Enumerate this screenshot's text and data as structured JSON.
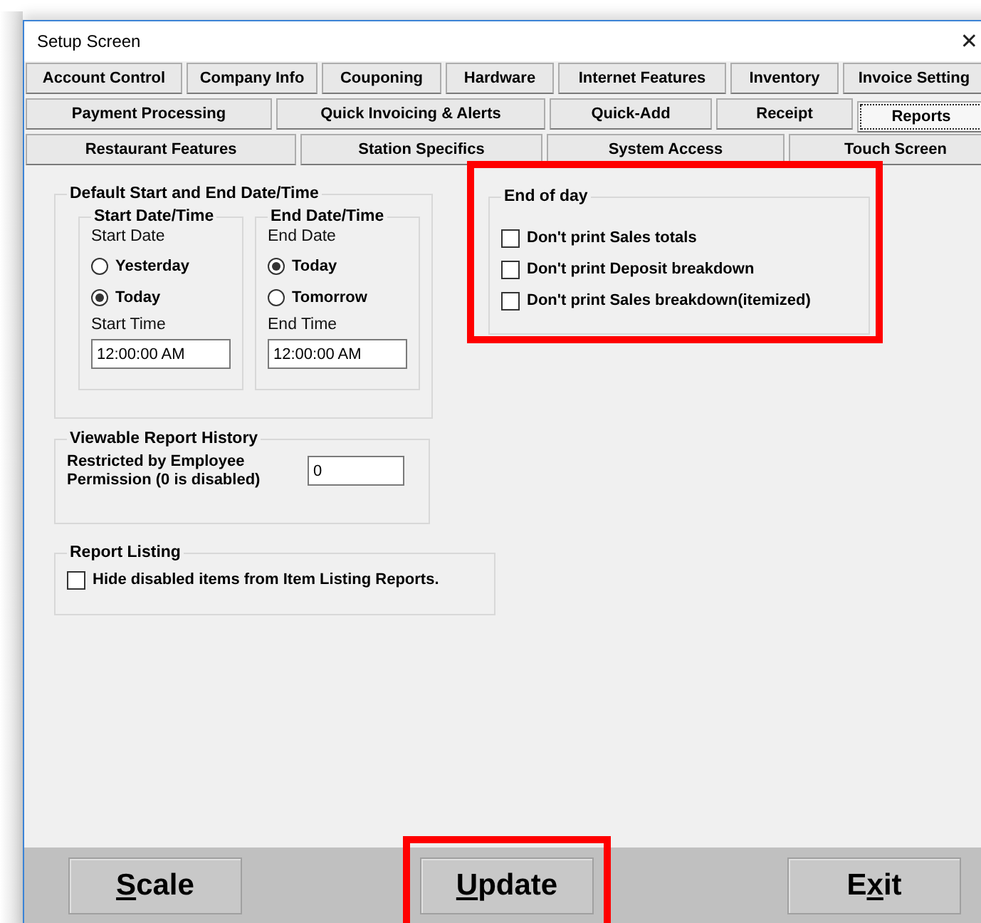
{
  "window": {
    "title": "Setup Screen",
    "close": "✕"
  },
  "tab_rows": [
    [
      {
        "label": "Account Control",
        "selected": false
      },
      {
        "label": "Company Info",
        "selected": false
      },
      {
        "label": "Couponing",
        "selected": false
      },
      {
        "label": "Hardware",
        "selected": false
      },
      {
        "label": "Internet Features",
        "selected": false
      },
      {
        "label": "Inventory",
        "selected": false
      },
      {
        "label": "Invoice Setting",
        "selected": false
      }
    ],
    [
      {
        "label": "Payment Processing",
        "selected": false
      },
      {
        "label": "Quick Invoicing & Alerts",
        "selected": false
      },
      {
        "label": "Quick-Add",
        "selected": false
      },
      {
        "label": "Receipt",
        "selected": false
      },
      {
        "label": "Reports",
        "selected": true
      }
    ],
    [
      {
        "label": "Restaurant Features",
        "selected": false
      },
      {
        "label": "Station Specifics",
        "selected": false
      },
      {
        "label": "System Access",
        "selected": false
      },
      {
        "label": "Touch Screen",
        "selected": false
      }
    ]
  ],
  "date_time_group": {
    "title": "Default Start and End Date/Time",
    "panels": [
      {
        "title": "Start Date/Time",
        "date_label": "Start Date",
        "options": [
          {
            "label": "Yesterday",
            "selected": false
          },
          {
            "label": "Today",
            "selected": true
          }
        ],
        "time_label": "Start Time",
        "time_value": "12:00:00 AM"
      },
      {
        "title": "End Date/Time",
        "date_label": "End Date",
        "options": [
          {
            "label": "Today",
            "selected": true
          },
          {
            "label": "Tomorrow",
            "selected": false
          }
        ],
        "time_label": "End Time",
        "time_value": "12:00:00 AM"
      }
    ]
  },
  "history_group": {
    "title": "Viewable Report History",
    "label": "Restricted by Employee Permission (0 is disabled)",
    "value": "0"
  },
  "listing_group": {
    "title": "Report Listing",
    "options": [
      {
        "label": "Hide disabled items from Item Listing Reports.",
        "checked": false
      }
    ]
  },
  "end_of_day_group": {
    "title": "End of day",
    "highlighted": true,
    "options": [
      {
        "label": "Don't print Sales totals",
        "checked": false
      },
      {
        "label": "Don't print Deposit breakdown",
        "checked": false
      },
      {
        "label": "Don't print Sales breakdown(itemized)",
        "checked": false
      }
    ]
  },
  "buttons": [
    {
      "accel": "S",
      "after": "cale",
      "highlighted": false
    },
    {
      "accel": "U",
      "after": "pdate",
      "highlighted": true
    },
    {
      "before": "E",
      "accel": "x",
      "after": "it",
      "highlighted": false
    }
  ]
}
